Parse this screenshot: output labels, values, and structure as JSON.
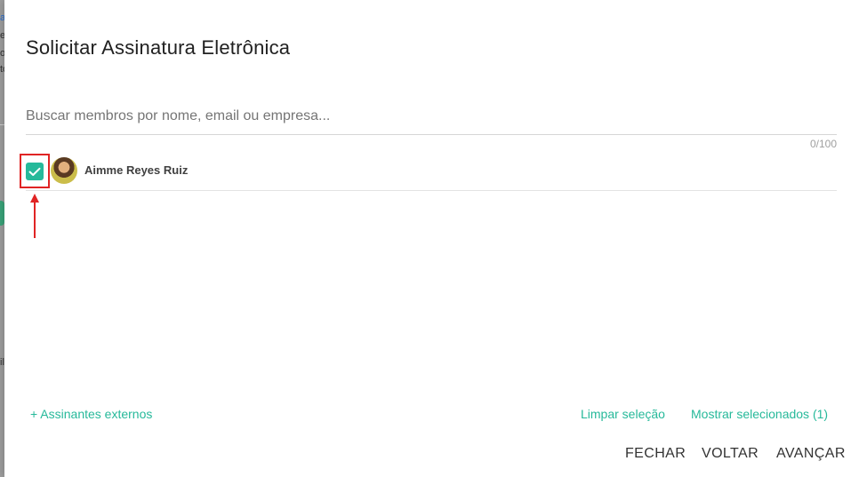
{
  "dialog": {
    "title": "Solicitar Assinatura Eletrônica",
    "search": {
      "placeholder": "Buscar membros por nome, email ou empresa...",
      "value": "",
      "counter": "0/100"
    },
    "members": [
      {
        "name": "Aimme Reyes Ruiz",
        "selected": true
      }
    ],
    "links": {
      "external_signers": "+ Assinantes externos",
      "clear_selection": "Limpar seleção",
      "show_selected": "Mostrar selecionados (1)"
    },
    "actions": {
      "close": "FECHAR",
      "back": "VOLTAR",
      "next": "AVANÇAR"
    }
  },
  "colors": {
    "accent": "#26b99a",
    "annotation": "#e02424",
    "text": "#212121"
  }
}
